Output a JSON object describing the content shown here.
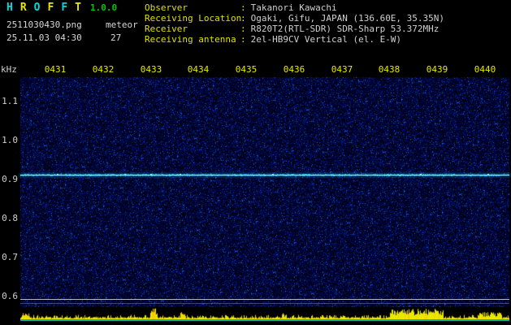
{
  "header": {
    "title_letters": [
      "H",
      "R",
      "O",
      "F",
      "F",
      "T"
    ],
    "version": "1.0.0",
    "filename": "2511030430.png",
    "mode": "meteor",
    "datetime": "25.11.03 04:30",
    "count": "27",
    "separator": ":",
    "info_rows": [
      {
        "label": "Observer",
        "value": "Takanori Kawachi"
      },
      {
        "label": "Receiving Location",
        "value": "Ogaki, Gifu, JAPAN (136.60E, 35.35N)"
      },
      {
        "label": "Receiver",
        "value": "R820T2(RTL-SDR) SDR-Sharp 53.372MHz"
      },
      {
        "label": "Receiving antenna",
        "value": "2el-HB9CV Vertical (el. E-W)"
      }
    ]
  },
  "axes": {
    "freq_unit": "kHz",
    "time_ticks": [
      "0431",
      "0432",
      "0433",
      "0434",
      "0435",
      "0436",
      "0437",
      "0438",
      "0439",
      "0440"
    ],
    "freq_ticks": [
      "1.1",
      "1.0",
      "0.9",
      "0.8",
      "0.7",
      "0.6"
    ]
  },
  "colors": {
    "label_yellow": "#e0e000",
    "tick_yellow": "#e8e800",
    "value_gray": "#d0d0d0",
    "carrier_cyan": "#9ff3ff",
    "baseline_cyan": "#00b4b4",
    "version_green": "#00c800",
    "noise_blue": "#000080"
  },
  "chart_data": {
    "type": "heatmap",
    "title": "HROFFT 1.0.0 meteor echo spectrogram 25.11.03 04:30 (2511030430.png)",
    "ylabel": "kHz",
    "x_ticks": [
      "0431",
      "0432",
      "0433",
      "0434",
      "0435",
      "0436",
      "0437",
      "0438",
      "0439",
      "0440"
    ],
    "y_ticks": [
      1.1,
      1.0,
      0.9,
      0.8,
      0.7,
      0.6
    ],
    "x_range": [
      "0430",
      "0440"
    ],
    "y_range": [
      0.57,
      1.16
    ],
    "echo_count": 27,
    "features": [
      "continuous carrier line at ~0.91 kHz across full width",
      "faint horizontal interference line near 0.59 kHz",
      "dark blue random noise background",
      "yellow signal-level strip along bottom with bursts near 0433 and 0437-0438"
    ]
  }
}
